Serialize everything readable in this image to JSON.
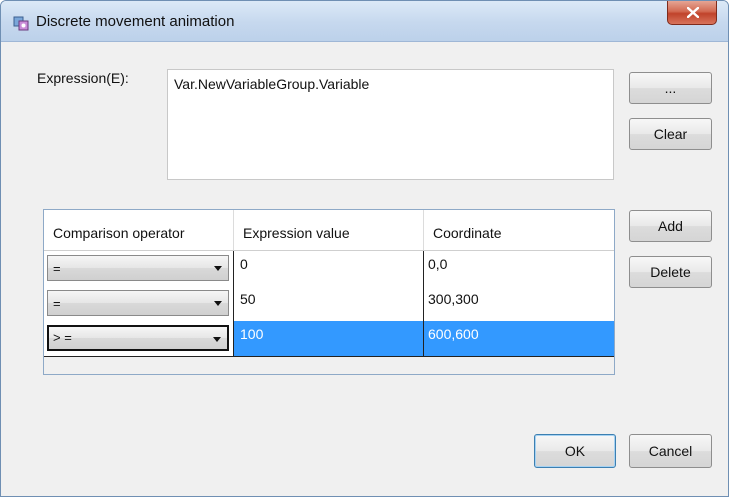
{
  "window": {
    "title": "Discrete movement animation"
  },
  "expression": {
    "label": "Expression(E):",
    "value": "Var.NewVariableGroup.Variable",
    "browse_label": "...",
    "clear_label": "Clear"
  },
  "table": {
    "headers": [
      "Comparison operator",
      "Expression value",
      "Coordinate"
    ],
    "rows": [
      {
        "operator": "=",
        "value": "0",
        "coordinate": "0,0"
      },
      {
        "operator": "=",
        "value": "50",
        "coordinate": "300,300"
      },
      {
        "operator": "> =",
        "value": "100",
        "coordinate": "600,600"
      }
    ],
    "add_label": "Add",
    "delete_label": "Delete"
  },
  "footer": {
    "ok_label": "OK",
    "cancel_label": "Cancel"
  },
  "colors": {
    "selection": "#3399ff",
    "titlebar": "#c6d8ee",
    "close": "#c0432b"
  }
}
